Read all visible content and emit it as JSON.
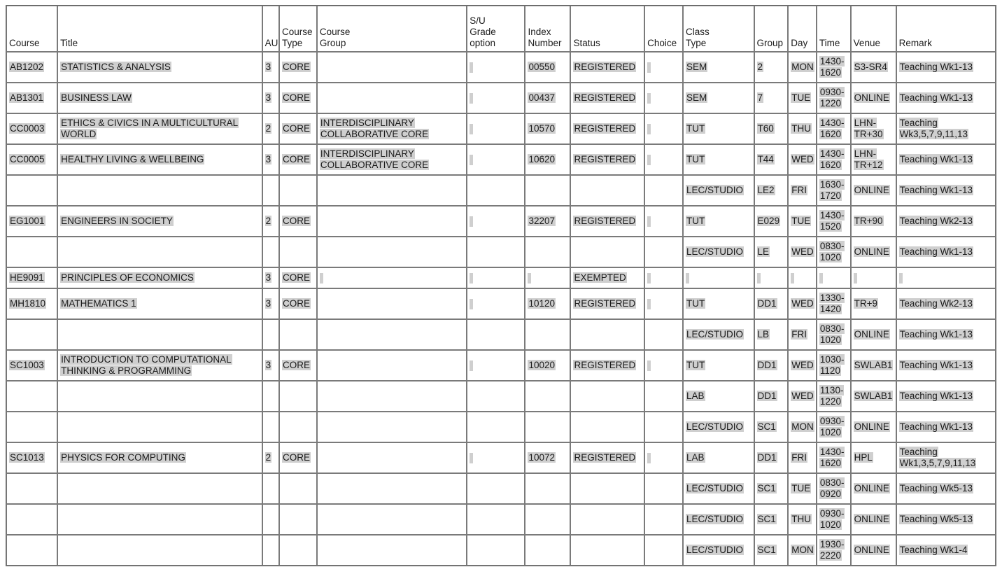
{
  "table": {
    "headers": [
      {
        "key": "course",
        "label": "Course"
      },
      {
        "key": "title",
        "label": "Title"
      },
      {
        "key": "au",
        "label": "AU"
      },
      {
        "key": "course_type",
        "label": "Course\nType"
      },
      {
        "key": "course_group",
        "label": "Course\nGroup"
      },
      {
        "key": "su_grade_option",
        "label": "S/U\nGrade\noption"
      },
      {
        "key": "index_number",
        "label": "Index\nNumber"
      },
      {
        "key": "status",
        "label": "Status"
      },
      {
        "key": "choice",
        "label": "Choice"
      },
      {
        "key": "class_type",
        "label": "Class\nType"
      },
      {
        "key": "group",
        "label": "Group"
      },
      {
        "key": "day",
        "label": "Day"
      },
      {
        "key": "time",
        "label": "Time"
      },
      {
        "key": "venue",
        "label": "Venue"
      },
      {
        "key": "remark",
        "label": "Remark"
      }
    ],
    "rows": [
      {
        "course": "AB1202",
        "title": "STATISTICS & ANALYSIS",
        "au": "3",
        "course_type": "CORE",
        "course_group": "",
        "su_grade_option": "",
        "index_number": "00550",
        "status": "REGISTERED",
        "choice": "",
        "class_type": "SEM",
        "group": "2",
        "day": "MON",
        "time": "1430-1620",
        "venue": "S3-SR4",
        "remark": "Teaching Wk1-13",
        "su_tick": true,
        "choice_tick": true,
        "group_tick": true
      },
      {
        "course": "AB1301",
        "title": "BUSINESS LAW",
        "au": "3",
        "course_type": "CORE",
        "course_group": "",
        "su_grade_option": "",
        "index_number": "00437",
        "status": "REGISTERED",
        "choice": "",
        "class_type": "SEM",
        "group": "7",
        "day": "TUE",
        "time": "0930-1220",
        "venue": "ONLINE",
        "remark": "Teaching Wk1-13",
        "su_tick": true,
        "choice_tick": true,
        "group_tick": true
      },
      {
        "course": "CC0003",
        "title": "ETHICS & CIVICS IN A MULTICULTURAL WORLD",
        "au": "2",
        "course_type": "CORE",
        "course_group": "INTERDISCIPLINARY COLLABORATIVE CORE",
        "su_grade_option": "",
        "index_number": "10570",
        "status": "REGISTERED",
        "choice": "",
        "class_type": "TUT",
        "group": "T60",
        "day": "THU",
        "time": "1430-1620",
        "venue": "LHN-TR+30",
        "remark": "Teaching Wk3,5,7,9,11,13",
        "su_tick": true,
        "choice_tick": true,
        "group_tick": false
      },
      {
        "course": "CC0005",
        "title": "HEALTHY LIVING & WELLBEING",
        "au": "3",
        "course_type": "CORE",
        "course_group": "INTERDISCIPLINARY COLLABORATIVE CORE",
        "su_grade_option": "",
        "index_number": "10620",
        "status": "REGISTERED",
        "choice": "",
        "class_type": "TUT",
        "group": "T44",
        "day": "WED",
        "time": "1430-1620",
        "venue": "LHN-TR+12",
        "remark": "Teaching Wk1-13",
        "su_tick": true,
        "choice_tick": true,
        "group_tick": false
      },
      {
        "course": "",
        "title": "",
        "au": "",
        "course_type": "",
        "course_group": "",
        "su_grade_option": "",
        "index_number": "",
        "status": "",
        "choice": "",
        "class_type": "LEC/STUDIO",
        "group": "LE2",
        "day": "FRI",
        "time": "1630-1720",
        "venue": "ONLINE",
        "remark": "Teaching Wk1-13",
        "su_tick": false,
        "choice_tick": false,
        "group_tick": false
      },
      {
        "course": "EG1001",
        "title": "ENGINEERS IN SOCIETY",
        "au": "2",
        "course_type": "CORE",
        "course_group": "",
        "su_grade_option": "",
        "index_number": "32207",
        "status": "REGISTERED",
        "choice": "",
        "class_type": "TUT",
        "group": "E029",
        "day": "TUE",
        "time": "1430-1520",
        "venue": "TR+90",
        "remark": "Teaching Wk2-13",
        "su_tick": true,
        "choice_tick": true,
        "group_tick": true
      },
      {
        "course": "",
        "title": "",
        "au": "",
        "course_type": "",
        "course_group": "",
        "su_grade_option": "",
        "index_number": "",
        "status": "",
        "choice": "",
        "class_type": "LEC/STUDIO",
        "group": "LE",
        "day": "WED",
        "time": "0830-1020",
        "venue": "ONLINE",
        "remark": "Teaching Wk1-13",
        "su_tick": false,
        "choice_tick": false,
        "group_tick": false
      },
      {
        "course": "HE9091",
        "title": "PRINCIPLES OF ECONOMICS",
        "au": "3",
        "course_type": "CORE",
        "course_group": "",
        "su_grade_option": "",
        "index_number": "",
        "status": "EXEMPTED",
        "choice": "",
        "class_type": "",
        "group": "",
        "day": "",
        "time": "",
        "venue": "",
        "remark": "",
        "su_tick": true,
        "choice_tick": true,
        "group_tick": true,
        "slim": true,
        "extra_ticks": [
          "course_group",
          "index_number",
          "class_type",
          "group",
          "day",
          "time",
          "venue",
          "remark"
        ]
      },
      {
        "course": "MH1810",
        "title": "MATHEMATICS 1",
        "au": "3",
        "course_type": "CORE",
        "course_group": "",
        "su_grade_option": "",
        "index_number": "10120",
        "status": "REGISTERED",
        "choice": "",
        "class_type": "TUT",
        "group": "DD1",
        "day": "WED",
        "time": "1330-1420",
        "venue": "TR+9",
        "remark": "Teaching Wk2-13",
        "su_tick": true,
        "choice_tick": true,
        "group_tick": true
      },
      {
        "course": "",
        "title": "",
        "au": "",
        "course_type": "",
        "course_group": "",
        "su_grade_option": "",
        "index_number": "",
        "status": "",
        "choice": "",
        "class_type": "LEC/STUDIO",
        "group": "LB",
        "day": "FRI",
        "time": "0830-1020",
        "venue": "ONLINE",
        "remark": "Teaching Wk1-13",
        "su_tick": false,
        "choice_tick": false,
        "group_tick": false
      },
      {
        "course": "SC1003",
        "title": "INTRODUCTION TO COMPUTATIONAL THINKING & PROGRAMMING",
        "au": "3",
        "course_type": "CORE",
        "course_group": "",
        "su_grade_option": "",
        "index_number": "10020",
        "status": "REGISTERED",
        "choice": "",
        "class_type": "TUT",
        "group": "DD1",
        "day": "WED",
        "time": "1030-1120",
        "venue": "SWLAB1",
        "remark": "Teaching Wk1-13",
        "su_tick": true,
        "choice_tick": true,
        "group_tick": true
      },
      {
        "course": "",
        "title": "",
        "au": "",
        "course_type": "",
        "course_group": "",
        "su_grade_option": "",
        "index_number": "",
        "status": "",
        "choice": "",
        "class_type": "LAB",
        "group": "DD1",
        "day": "WED",
        "time": "1130-1220",
        "venue": "SWLAB1",
        "remark": "Teaching Wk1-13",
        "su_tick": false,
        "choice_tick": false,
        "group_tick": false
      },
      {
        "course": "",
        "title": "",
        "au": "",
        "course_type": "",
        "course_group": "",
        "su_grade_option": "",
        "index_number": "",
        "status": "",
        "choice": "",
        "class_type": "LEC/STUDIO",
        "group": "SC1",
        "day": "MON",
        "time": "0930-1020",
        "venue": "ONLINE",
        "remark": "Teaching Wk1-13",
        "su_tick": false,
        "choice_tick": false,
        "group_tick": false
      },
      {
        "course": "SC1013",
        "title": "PHYSICS FOR COMPUTING",
        "au": "2",
        "course_type": "CORE",
        "course_group": "",
        "su_grade_option": "",
        "index_number": "10072",
        "status": "REGISTERED",
        "choice": "",
        "class_type": "LAB",
        "group": "DD1",
        "day": "FRI",
        "time": "1430-1620",
        "venue": "HPL",
        "remark": "Teaching Wk1,3,5,7,9,11,13",
        "su_tick": true,
        "choice_tick": true,
        "group_tick": true
      },
      {
        "course": "",
        "title": "",
        "au": "",
        "course_type": "",
        "course_group": "",
        "su_grade_option": "",
        "index_number": "",
        "status": "",
        "choice": "",
        "class_type": "LEC/STUDIO",
        "group": "SC1",
        "day": "TUE",
        "time": "0830-0920",
        "venue": "ONLINE",
        "remark": "Teaching Wk5-13",
        "su_tick": false,
        "choice_tick": false,
        "group_tick": false
      },
      {
        "course": "",
        "title": "",
        "au": "",
        "course_type": "",
        "course_group": "",
        "su_grade_option": "",
        "index_number": "",
        "status": "",
        "choice": "",
        "class_type": "LEC/STUDIO",
        "group": "SC1",
        "day": "THU",
        "time": "0930-1020",
        "venue": "ONLINE",
        "remark": "Teaching Wk5-13",
        "su_tick": false,
        "choice_tick": false,
        "group_tick": false
      },
      {
        "course": "",
        "title": "",
        "au": "",
        "course_type": "",
        "course_group": "",
        "su_grade_option": "",
        "index_number": "",
        "status": "",
        "choice": "",
        "class_type": "LEC/STUDIO",
        "group": "SC1",
        "day": "MON",
        "time": "1930-2220",
        "venue": "ONLINE",
        "remark": "Teaching Wk1-4",
        "su_tick": false,
        "choice_tick": false,
        "group_tick": false
      }
    ]
  },
  "colors": {
    "selection_highlight": "#cfcfcf",
    "cell_border": "#7a7a7a",
    "text": "#1b1b1b",
    "page_background": "#ffffff"
  }
}
